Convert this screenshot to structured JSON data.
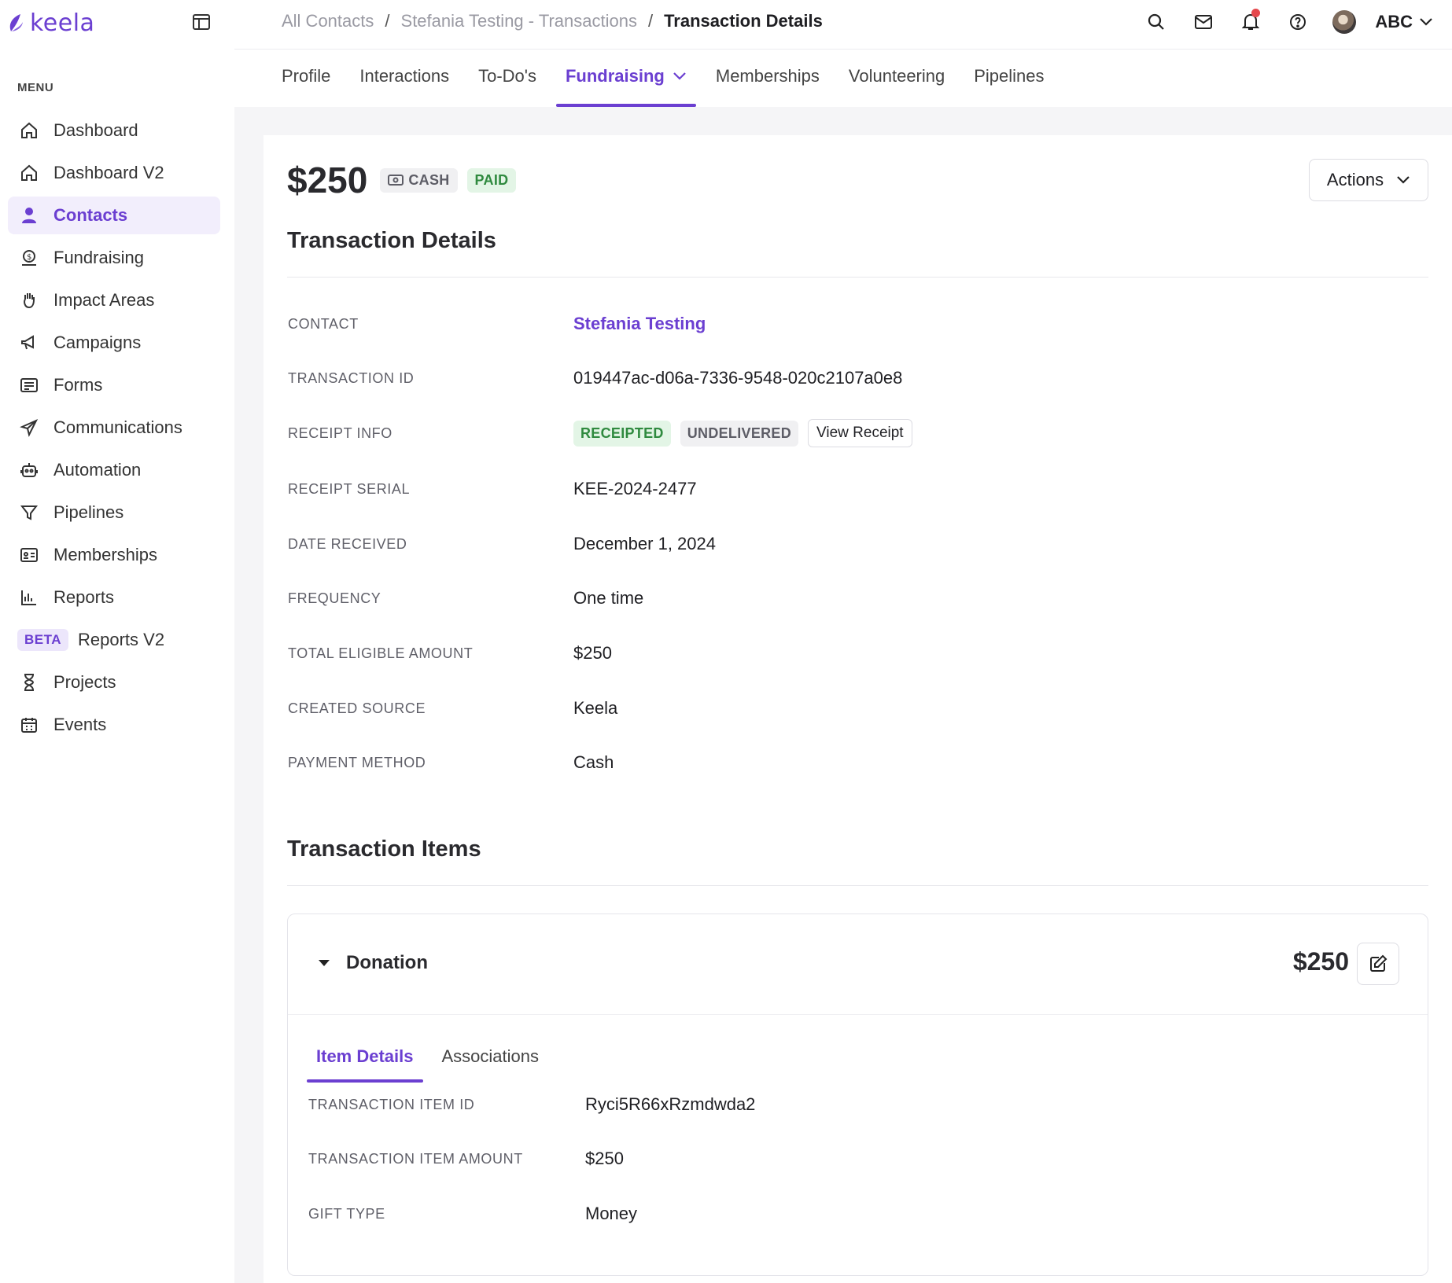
{
  "app": {
    "logo_text": "keela",
    "accent_color": "#6b3fd1"
  },
  "sidebar": {
    "menu_label": "MENU",
    "items": [
      {
        "label": "Dashboard",
        "icon": "home-icon",
        "active": false
      },
      {
        "label": "Dashboard V2",
        "icon": "home-icon",
        "active": false
      },
      {
        "label": "Contacts",
        "icon": "user-icon",
        "active": true
      },
      {
        "label": "Fundraising",
        "icon": "fundraising-icon",
        "active": false
      },
      {
        "label": "Impact Areas",
        "icon": "hand-icon",
        "active": false
      },
      {
        "label": "Campaigns",
        "icon": "megaphone-icon",
        "active": false
      },
      {
        "label": "Forms",
        "icon": "form-icon",
        "active": false
      },
      {
        "label": "Communications",
        "icon": "send-icon",
        "active": false
      },
      {
        "label": "Automation",
        "icon": "robot-icon",
        "active": false
      },
      {
        "label": "Pipelines",
        "icon": "filter-icon",
        "active": false
      },
      {
        "label": "Memberships",
        "icon": "id-card-icon",
        "active": false
      },
      {
        "label": "Reports",
        "icon": "bar-chart-icon",
        "active": false
      },
      {
        "label": "Reports V2",
        "badge": "BETA",
        "active": false
      },
      {
        "label": "Projects",
        "icon": "hourglass-icon",
        "active": false
      },
      {
        "label": "Events",
        "icon": "calendar-icon",
        "active": false
      }
    ]
  },
  "header": {
    "breadcrumb": {
      "all_contacts": "All Contacts",
      "sep": "/",
      "transactions": "Stefania Testing - Transactions",
      "current": "Transaction Details"
    },
    "user_name": "ABC",
    "notification_dot_color": "#e5484d"
  },
  "tabs": [
    {
      "label": "Profile",
      "active": false
    },
    {
      "label": "Interactions",
      "active": false
    },
    {
      "label": "To-Do's",
      "active": false
    },
    {
      "label": "Fundraising",
      "active": true,
      "has_dropdown": true
    },
    {
      "label": "Memberships",
      "active": false
    },
    {
      "label": "Volunteering",
      "active": false
    },
    {
      "label": "Pipelines",
      "active": false
    }
  ],
  "transaction": {
    "amount": "$250",
    "method_pill": "CASH",
    "status_pill": "PAID",
    "actions_label": "Actions",
    "details_title": "Transaction Details",
    "details": {
      "contact": {
        "label": "CONTACT",
        "value": "Stefania Testing"
      },
      "transaction_id": {
        "label": "TRANSACTION ID",
        "value": "019447ac-d06a-7336-9548-020c2107a0e8"
      },
      "receipt_info": {
        "label": "RECEIPT INFO",
        "badge_receipted": "RECEIPTED",
        "badge_undelivered": "UNDELIVERED",
        "view_receipt": "View Receipt"
      },
      "receipt_serial": {
        "label": "RECEIPT SERIAL",
        "value": "KEE-2024-2477"
      },
      "date_received": {
        "label": "DATE RECEIVED",
        "value": "December 1, 2024"
      },
      "frequency": {
        "label": "FREQUENCY",
        "value": "One time"
      },
      "total_eligible": {
        "label": "TOTAL ELIGIBLE AMOUNT",
        "value": "$250"
      },
      "created_source": {
        "label": "CREATED SOURCE",
        "value": "Keela"
      },
      "payment_method": {
        "label": "PAYMENT METHOD",
        "value": "Cash"
      }
    },
    "items_title": "Transaction Items",
    "item": {
      "name": "Donation",
      "amount": "$250",
      "tabs": {
        "details": "Item Details",
        "associations": "Associations"
      },
      "rows": {
        "item_id": {
          "label": "TRANSACTION ITEM ID",
          "value": "Ryci5R66xRzmdwda2"
        },
        "item_amount": {
          "label": "TRANSACTION ITEM AMOUNT",
          "value": "$250"
        },
        "gift_type": {
          "label": "GIFT TYPE",
          "value": "Money"
        }
      }
    }
  }
}
